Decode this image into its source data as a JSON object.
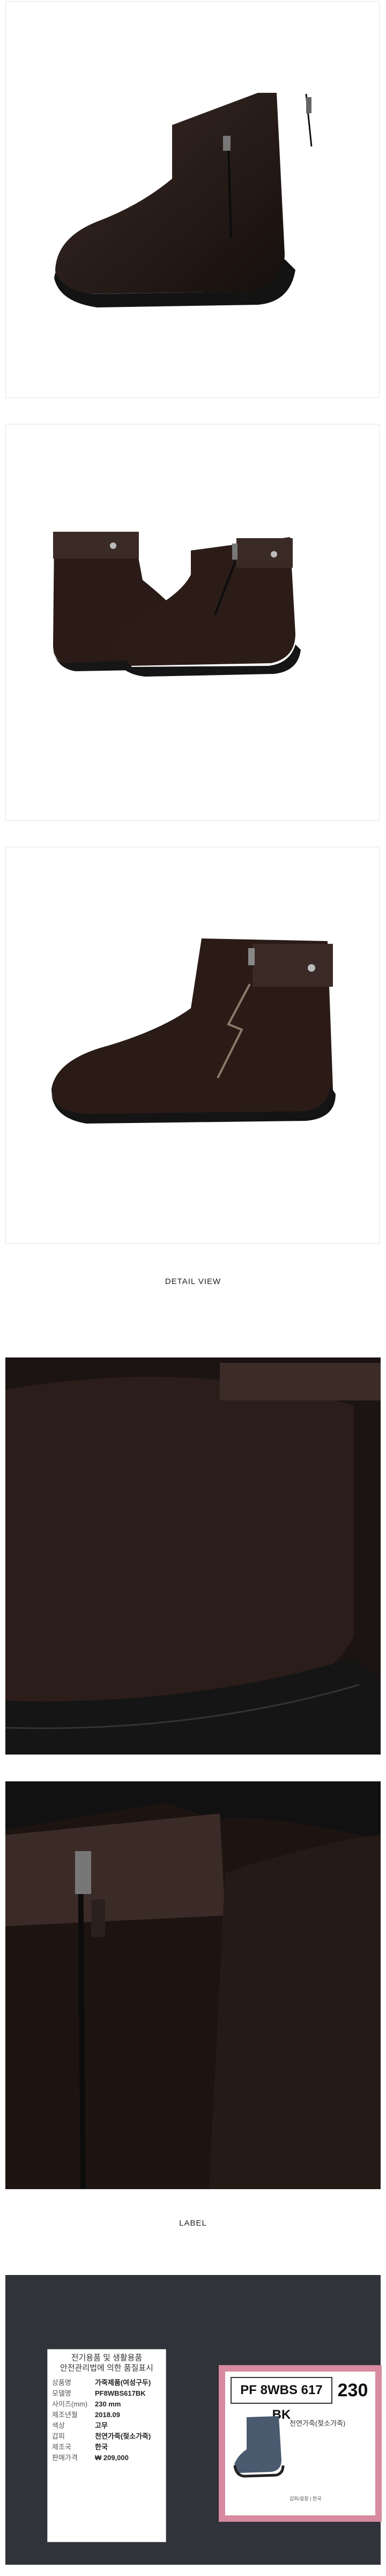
{
  "sections": {
    "detail_title": "DETAIL VIEW",
    "label_title": "LABEL"
  },
  "label_left": {
    "header_line1": "전기용품 및 생활용품",
    "header_line2": "안전관리법에 의한 품질표시",
    "rows": [
      {
        "key": "상품명",
        "value": "가죽제품(여성구두)"
      },
      {
        "key": "모델명",
        "value": "PF8WBS617BK"
      },
      {
        "key": "사이즈(mm)",
        "value": "230 mm"
      },
      {
        "key": "제조년월",
        "value": "2018.09"
      },
      {
        "key": "색상",
        "value": "고무"
      },
      {
        "key": "갑피",
        "value": "천연가죽(젖소가죽)"
      },
      {
        "key": "제조국",
        "value": "한국"
      },
      {
        "key": "판매가격",
        "value": "₩ 209,000"
      }
    ]
  },
  "label_right": {
    "sku": "PF 8WBS 617 BK",
    "size": "230",
    "material": "천연가죽(젖소가죽)",
    "bottom_small": "갑피/겉창 | 한국"
  },
  "colors": {
    "leather": "#2a1b17",
    "sole": "#1a1a1a",
    "label_border": "#d78aa0"
  }
}
